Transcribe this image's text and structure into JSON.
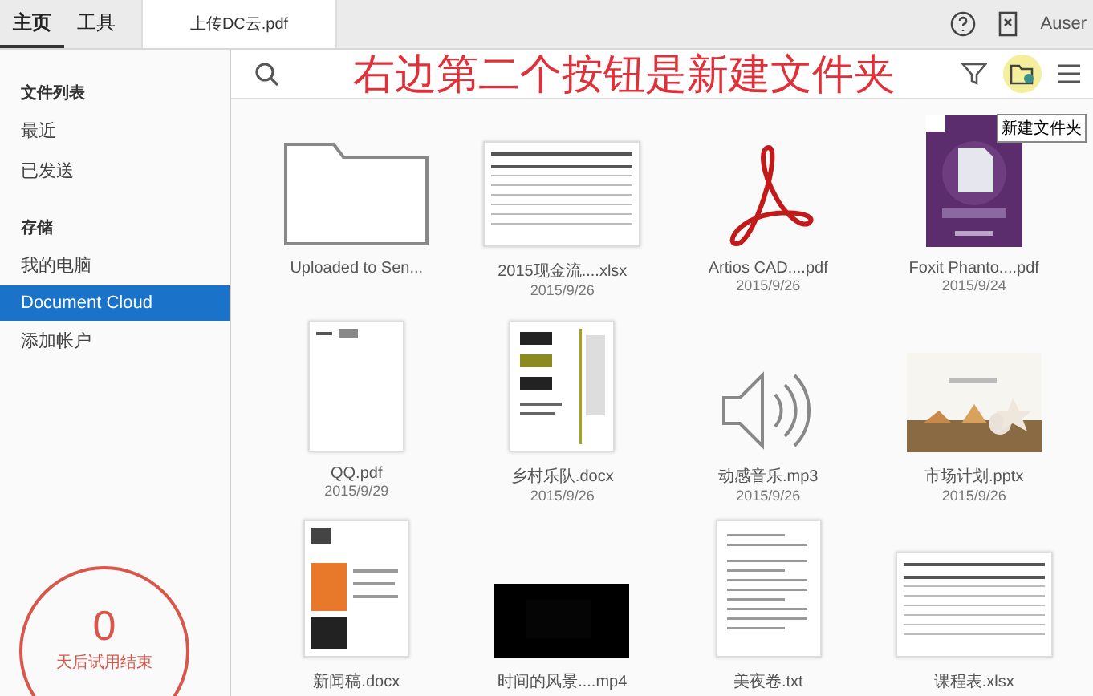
{
  "top_tabs": [
    {
      "label": "主页",
      "selected": true
    },
    {
      "label": "工具",
      "selected": false
    }
  ],
  "document_tab": "上传DC云.pdf",
  "user": "Auser",
  "sidebar": {
    "sections": [
      {
        "heading": "文件列表",
        "items": [
          {
            "label": "最近",
            "selected": false
          },
          {
            "label": "已发送",
            "selected": false
          }
        ]
      },
      {
        "heading": "存储",
        "items": [
          {
            "label": "我的电脑",
            "selected": false
          },
          {
            "label": "Document Cloud",
            "selected": true
          },
          {
            "label": "添加帐户",
            "selected": false
          }
        ]
      }
    ],
    "trial": {
      "days": "0",
      "label": "天后试用结束"
    }
  },
  "annotation": "右边第二个按钮是新建文件夹",
  "tooltip": "新建文件夹",
  "files": [
    {
      "kind": "folder",
      "name": "Uploaded to Sen..."
    },
    {
      "kind": "sheet",
      "name": "2015现金流....xlsx",
      "date": "2015/9/26"
    },
    {
      "kind": "pdf",
      "name": "Artios CAD....pdf",
      "date": "2015/9/26"
    },
    {
      "kind": "cover",
      "name": "Foxit Phanto....pdf",
      "date": "2015/9/24"
    },
    {
      "kind": "doc",
      "name": "QQ.pdf",
      "date": "2015/9/29"
    },
    {
      "kind": "poster",
      "name": "乡村乐队.docx",
      "date": "2015/9/26"
    },
    {
      "kind": "audio",
      "name": "动感音乐.mp3",
      "date": "2015/9/26"
    },
    {
      "kind": "slide",
      "name": "市场计划.pptx",
      "date": "2015/9/26"
    },
    {
      "kind": "newsletter",
      "name": "新闻稿.docx"
    },
    {
      "kind": "video",
      "name": "时间的风景....mp4"
    },
    {
      "kind": "text",
      "name": "美夜卷.txt"
    },
    {
      "kind": "sheet",
      "name": "课程表.xlsx"
    }
  ]
}
